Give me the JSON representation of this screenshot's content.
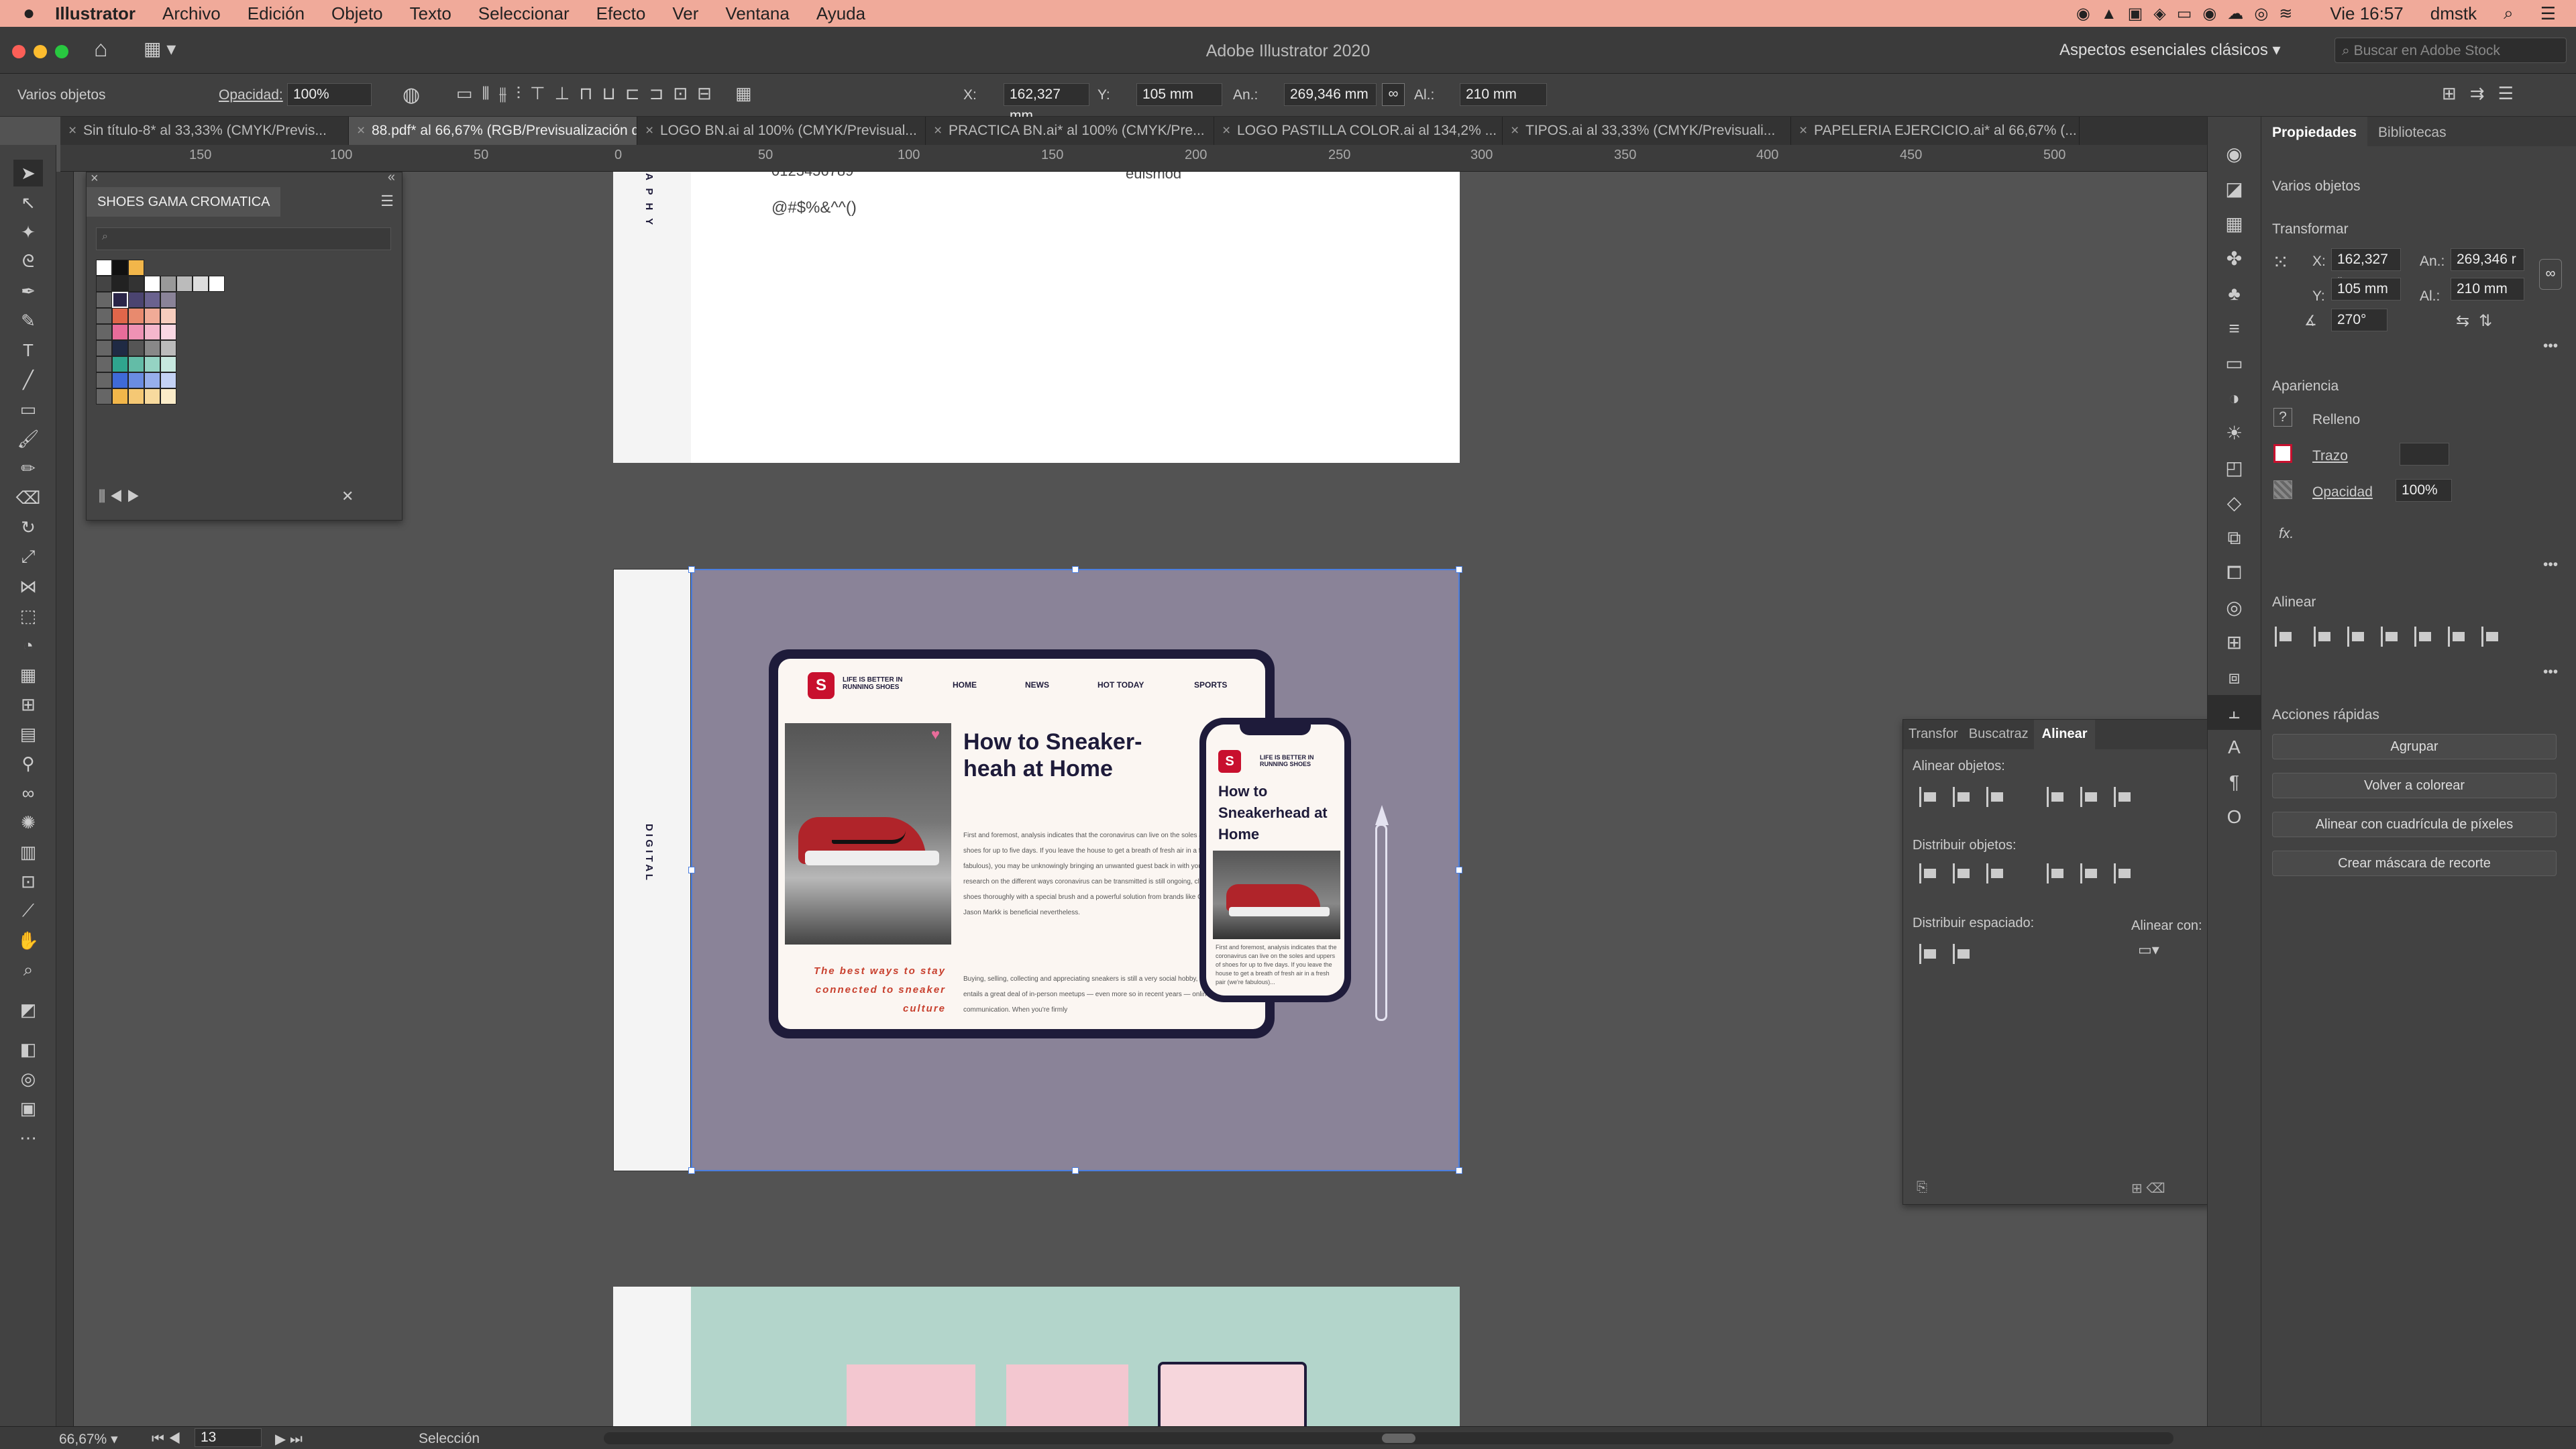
{
  "menubar": {
    "app": "Illustrator",
    "items": [
      "Archivo",
      "Edición",
      "Objeto",
      "Texto",
      "Seleccionar",
      "Efecto",
      "Ver",
      "Ventana",
      "Ayuda"
    ],
    "clock": "Vie 16:57",
    "user": "dmstk"
  },
  "titlebar": {
    "title": "Adobe Illustrator 2020",
    "workspace": "Aspectos esenciales clásicos",
    "search_placeholder": "Buscar en Adobe Stock"
  },
  "control": {
    "selection": "Varios objetos",
    "opacity_label": "Opacidad:",
    "opacity": "100%",
    "x_label": "X:",
    "x": "162,327 mm",
    "y_label": "Y:",
    "y": "105 mm",
    "w_label": "An.:",
    "w": "269,346 mm",
    "h_label": "Al.:",
    "h": "210 mm"
  },
  "tabs": [
    "Sin título-8* al 33,33% (CMYK/Previs...",
    "88.pdf* al 66,67% (RGB/Previsualización de GPU)",
    "LOGO BN.ai al 100% (CMYK/Previsual...",
    "PRACTICA BN.ai* al 100% (CMYK/Pre...",
    "LOGO PASTILLA COLOR.ai al 134,2% ...",
    "TIPOS.ai al 33,33% (CMYK/Previsuali...",
    "PAPELERIA EJERCICIO.ai* al 66,67% (..."
  ],
  "ruler_top": [
    "150",
    "100",
    "50",
    "0",
    "50",
    "100",
    "150",
    "200",
    "250",
    "300",
    "350",
    "400",
    "450",
    "500"
  ],
  "ruler_left": [
    "1",
    "0",
    "0",
    "5",
    "0",
    "0",
    "5",
    "0",
    "1",
    "0",
    "0",
    "1",
    "5",
    "0",
    "2",
    "0",
    "0",
    "2",
    "5",
    "0",
    "3",
    "0",
    "0"
  ],
  "swatches": {
    "title": "SHOES GAMA CROMATICA"
  },
  "artboard_top": {
    "text1": "0123456789",
    "text2": "@#$%&^^()",
    "text3": "euismod",
    "side": "A P H Y"
  },
  "artboard_mid": {
    "side": "D I G I T A L"
  },
  "tablet": {
    "brand": "LIFE IS BETTER IN RUNNING SHOES",
    "nav": [
      "HOME",
      "NEWS",
      "HOT TODAY",
      "SPORTS"
    ],
    "headline": "How to Sneaker-heah at Home",
    "tagline": "The best ways to stay connected to sneaker culture",
    "body1": "First and foremost, analysis indicates that the coronavirus can live on the soles and uppers of shoes for up to five days. If you leave the house to get a breath of fresh air in a fresh pair (we're fabulous), you may be unknowingly bringing an unwanted guest back in with you. Although research on the different ways coronavirus can be transmitted is still ongoing, cleaning your shoes thoroughly with a special brush and a powerful solution from brands like Crep Protect or Jason Markk is beneficial nevertheless.",
    "body2": "Buying, selling, collecting and appreciating sneakers is still a very social hobby, one that typically entails a great deal of in-person meetups — even more so in recent years — online communication. When you're firmly"
  },
  "phone": {
    "brand": "LIFE IS BETTER IN RUNNING SHOES",
    "headline": "How to Sneakerhead at Home",
    "body": "First and foremost, analysis indicates that the coronavirus can live on the soles and uppers of shoes for up to five days. If you leave the house to get a breath of fresh air in a fresh pair (we're fabulous)..."
  },
  "align_panel": {
    "tabs": [
      "Transfor",
      "Buscatraz",
      "Alinear"
    ],
    "align_objects": "Alinear objetos:",
    "distribute_objects": "Distribuir objetos:",
    "distribute_spacing": "Distribuir espaciado:",
    "align_to": "Alinear con:"
  },
  "props": {
    "tabs": [
      "Propiedades",
      "Bibliotecas"
    ],
    "selection": "Varios objetos",
    "transform": "Transformar",
    "x": "162,327 r",
    "y": "105 mm",
    "w": "269,346 r",
    "h": "210 mm",
    "angle": "270°",
    "x_label": "X:",
    "y_label": "Y:",
    "w_label": "An.:",
    "h_label": "Al.:",
    "appearance": "Apariencia",
    "fill": "Relleno",
    "stroke": "Trazo",
    "opacity_label": "Opacidad",
    "opacity": "100%",
    "fx": "fx.",
    "align": "Alinear",
    "quick_actions": "Acciones rápidas",
    "btn_group": "Agrupar",
    "btn_recolor": "Volver a colorear",
    "btn_pixel": "Alinear con cuadrícula de píxeles",
    "btn_mask": "Crear máscara de recorte"
  },
  "status": {
    "zoom": "66,67%",
    "page": "13",
    "tool": "Selección"
  },
  "colors": {
    "menubar": "#f0aa9a",
    "artboard_purple": "#8a8398",
    "artboard_mint": "#b3d5cb",
    "selection": "#4a7ee0",
    "brand_red": "#c8102e",
    "device_frame": "#1e1b3a"
  }
}
